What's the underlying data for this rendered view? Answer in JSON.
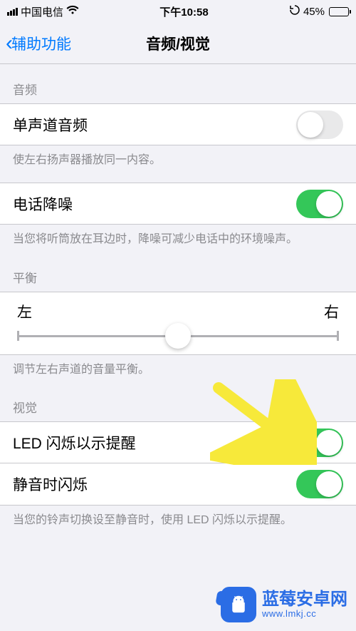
{
  "status_bar": {
    "carrier": "中国电信",
    "wifi_icon": "wifi-icon",
    "time": "下午10:58",
    "orientation_icon": "orientation-lock-icon",
    "battery_percent": "45%"
  },
  "nav": {
    "back_label": "辅助功能",
    "title": "音频/视觉"
  },
  "sections": {
    "audio_header": "音频",
    "mono_audio": {
      "label": "单声道音频",
      "on": false
    },
    "mono_footer": "使左右扬声器播放同一内容。",
    "phone_noise": {
      "label": "电话降噪",
      "on": true
    },
    "phone_noise_footer": "当您将听筒放在耳边时，降噪可减少电话中的环境噪声。",
    "balance_header": "平衡",
    "balance_left": "左",
    "balance_right": "右",
    "balance_footer": "调节左右声道的音量平衡。",
    "visual_header": "视觉",
    "led_flash": {
      "label": "LED 闪烁以示提醒",
      "on": true
    },
    "flash_silent": {
      "label": "静音时闪烁",
      "on": true
    },
    "visual_footer": "当您的铃声切换设至静音时，使用 LED 闪烁以示提醒。"
  },
  "watermark": {
    "title": "蓝莓安卓网",
    "url": "www.lmkj.cc"
  }
}
